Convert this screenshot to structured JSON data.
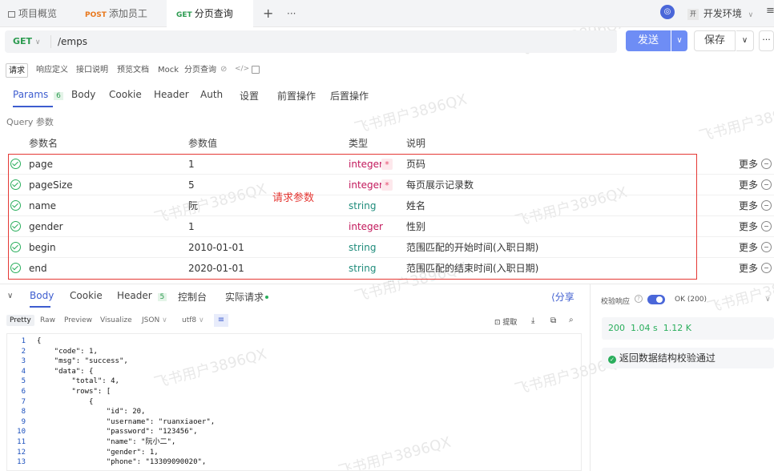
{
  "tabs": [
    {
      "label": "项目概览",
      "method": ""
    },
    {
      "label": "添加员工",
      "method": "POST"
    },
    {
      "label": "分页查询",
      "method": "GET"
    }
  ],
  "env": {
    "badge": "开",
    "label": "开发环境"
  },
  "request": {
    "method": "GET",
    "url": "/emps",
    "send_label": "发送",
    "save_label": "保存"
  },
  "subtabs": [
    "请求",
    "响应定义",
    "接口说明",
    "预览文档",
    "Mock",
    "分页查询"
  ],
  "param_tabs": [
    {
      "label": "Params",
      "count": "6"
    },
    {
      "label": "Body"
    },
    {
      "label": "Cookie"
    },
    {
      "label": "Header"
    },
    {
      "label": "Auth"
    },
    {
      "label": "设置"
    },
    {
      "label": "前置操作"
    },
    {
      "label": "后置操作"
    }
  ],
  "query_section_label": "Query 参数",
  "columns": {
    "name": "参数名",
    "value": "参数值",
    "type": "类型",
    "desc": "说明"
  },
  "params": [
    {
      "name": "page",
      "value": "1",
      "type": "integer",
      "required": "*",
      "desc": "页码",
      "more": "更多"
    },
    {
      "name": "pageSize",
      "value": "5",
      "type": "integer",
      "required": "*",
      "desc": "每页展示记录数",
      "more": "更多"
    },
    {
      "name": "name",
      "value": "阮",
      "type": "string",
      "desc": "姓名",
      "more": "更多"
    },
    {
      "name": "gender",
      "value": "1",
      "type": "integer",
      "desc": "性别",
      "more": "更多"
    },
    {
      "name": "begin",
      "value": "2010-01-01",
      "type": "string",
      "desc": "范围匹配的开始时间(入职日期)",
      "more": "更多"
    },
    {
      "name": "end",
      "value": "2020-01-01",
      "type": "string",
      "desc": "范围匹配的结束时间(入职日期)",
      "more": "更多"
    }
  ],
  "annotation": "请求参数",
  "response": {
    "tabs": [
      {
        "label": "Body"
      },
      {
        "label": "Cookie"
      },
      {
        "label": "Header",
        "count": "5"
      },
      {
        "label": "控制台"
      },
      {
        "label": "实际请求"
      }
    ],
    "share_label": "分享",
    "formats": [
      "Pretty",
      "Raw",
      "Preview",
      "Visualize"
    ],
    "format_select": "JSON",
    "encoding_select": "utf8",
    "extract_label": "提取",
    "code_lines": [
      "{",
      "    \"code\": 1,",
      "    \"msg\": \"success\",",
      "    \"data\": {",
      "        \"total\": 4,",
      "        \"rows\": [",
      "            {",
      "                \"id\": 20,",
      "                \"username\": \"ruanxiaoer\",",
      "                \"password\": \"123456\",",
      "                \"name\": \"阮小二\",",
      "                \"gender\": 1,",
      "                \"phone\": \"13309090020\","
    ]
  },
  "validation": {
    "label": "校验响应",
    "status_option": "OK (200)",
    "stats": {
      "status": "200",
      "time": "1.04 s",
      "size": "1.12 K"
    },
    "message": "返回数据结构校验通过"
  },
  "watermark": "飞书用户3896QX",
  "colors": {
    "accent": "#4a67d9",
    "highlight": "#e53935",
    "success": "#2aae5c",
    "required": "#e64a6e",
    "type_string": "#1f8c7b",
    "type_integer": "#c2185b"
  }
}
